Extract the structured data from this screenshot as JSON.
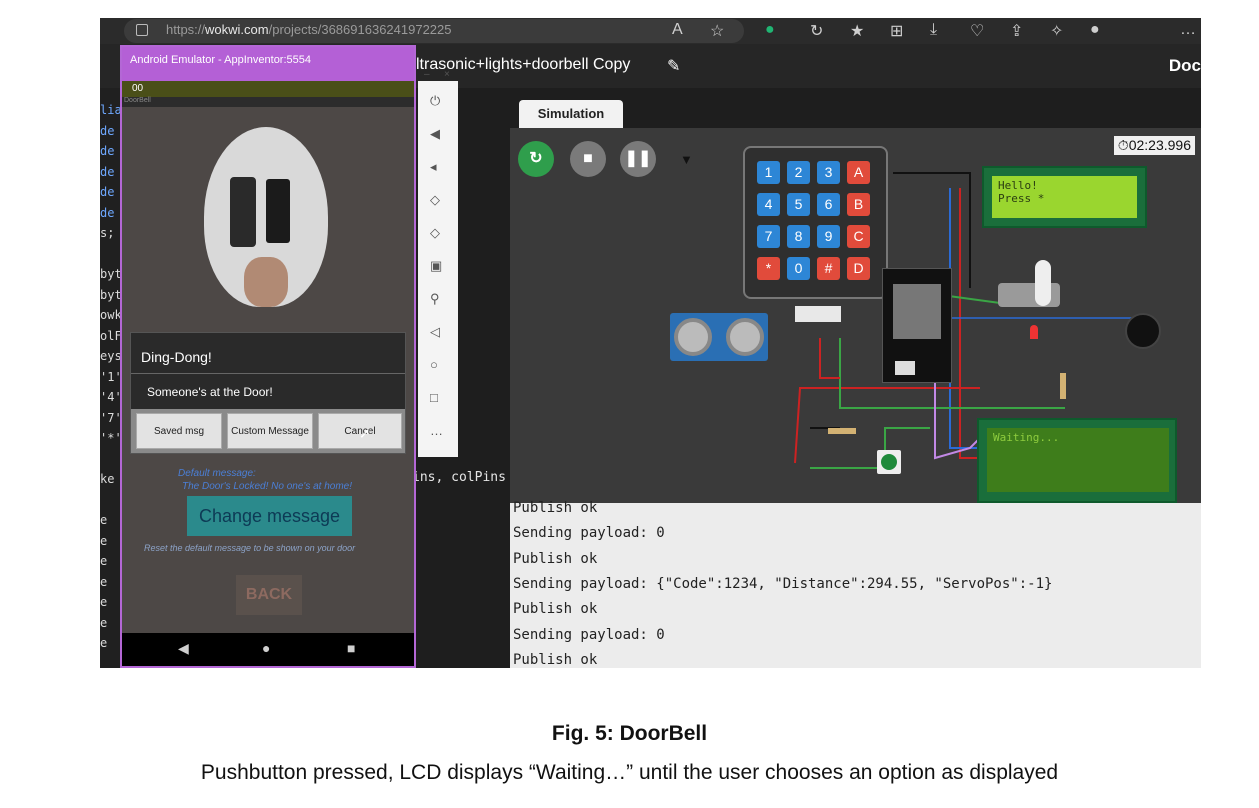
{
  "browser": {
    "url_prefix": "https://",
    "url_host": "wokwi.com",
    "url_path": "/projects/368691636241972225"
  },
  "wokwi": {
    "project_title": "ltrasonic+lights+doorbell Copy",
    "docs_label": "Doc",
    "sim_tab": "Simulation",
    "timer": "02:23.996",
    "code_fragment": "ins, colPins"
  },
  "editor": {
    "lines": [
      "liag",
      "de",
      "de",
      "de",
      "de",
      "de",
      "s;",
      "",
      "byt",
      "byt",
      "owk",
      "olF",
      "eys",
      "'1'",
      "'4'",
      "'7'",
      "'*'",
      "",
      "ke",
      "",
      "e",
      "e",
      "e",
      "e",
      "e",
      "e",
      "e"
    ]
  },
  "emulator": {
    "title": "Android Emulator - AppInventor:5554",
    "status": "00",
    "app_name": "DoorBell",
    "dialog": {
      "title": "Ding-Dong!",
      "message": "Someone's at the Door!",
      "saved_btn": "Saved msg",
      "custom_btn": "Custom Message",
      "cancel_btn": "Cancel"
    },
    "default_msg_label": "Default message:",
    "default_msg_text": "The Door's Locked! No one's at home!",
    "change_btn": "Change message",
    "reset_text": "Reset the default message to be shown on your door",
    "back_btn": "BACK"
  },
  "keypad_keys": [
    "1",
    "2",
    "3",
    "A",
    "4",
    "5",
    "6",
    "B",
    "7",
    "8",
    "9",
    "C",
    "*",
    "0",
    "#",
    "D"
  ],
  "lcd1": {
    "line1": "Hello!",
    "line2": "Press *"
  },
  "lcd2": {
    "line1": "Waiting..."
  },
  "console": {
    "lines": [
      "Publish ok",
      "Sending payload: 0",
      "Publish ok",
      "Sending payload: {\"Code\":1234, \"Distance\":294.55, \"ServoPos\":-1}",
      "Publish ok",
      "Sending payload: 0",
      "Publish ok"
    ]
  },
  "caption": "Fig. 5: DoorBell",
  "subcaption": "Pushbutton pressed, LCD displays “Waiting…” until the user chooses an option as displayed"
}
